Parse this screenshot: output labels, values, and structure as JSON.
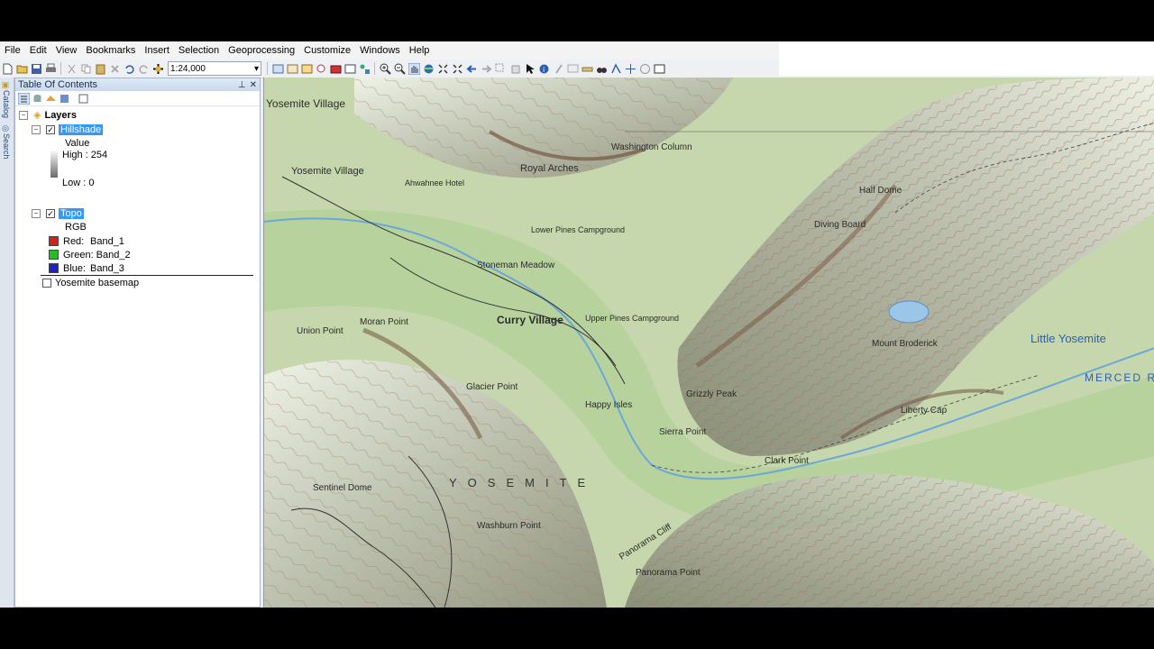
{
  "menu": [
    "File",
    "Edit",
    "View",
    "Bookmarks",
    "Insert",
    "Selection",
    "Geoprocessing",
    "Customize",
    "Windows",
    "Help"
  ],
  "toolbar": {
    "scale": "1:24,000"
  },
  "side_tabs": [
    "Catalog",
    "Search"
  ],
  "toc": {
    "title": "Table Of Contents",
    "root_label": "Layers",
    "hillshade": {
      "name": "Hillshade",
      "value_label": "Value",
      "high": "High : 254",
      "low": "Low : 0"
    },
    "topo": {
      "name": "Topo",
      "rgb_label": "RGB",
      "bands": [
        {
          "label": "Red:",
          "band": "Band_1",
          "color": "#d42020"
        },
        {
          "label": "Green:",
          "band": "Band_2",
          "color": "#22c022"
        },
        {
          "label": "Blue:",
          "band": "Band_3",
          "color": "#2020c8"
        }
      ]
    },
    "basemap": {
      "name": "Yosemite basemap"
    }
  },
  "map": {
    "labels": [
      "Yosemite Village",
      "Yosemite Village",
      "Royal Arches",
      "Washington Column",
      "Curry Village",
      "Stoneman Meadow",
      "Sierra Point",
      "Clark Point",
      "Mount Broderick",
      "Liberty Cap",
      "Little Yosemite",
      "Glacier Point",
      "Sentinel Dome",
      "Washburn Point",
      "Panorama Point",
      "Panorama Cliff",
      "Happy Isles",
      "Union Point",
      "Diving Board",
      "Half Dome",
      "Grizzly Peak",
      "YOSEMITE",
      "Ahwahnee Hotel",
      "Lower Pines Campground",
      "Upper Pines Campground",
      "Moran Point",
      "MERCED RIVER"
    ]
  }
}
